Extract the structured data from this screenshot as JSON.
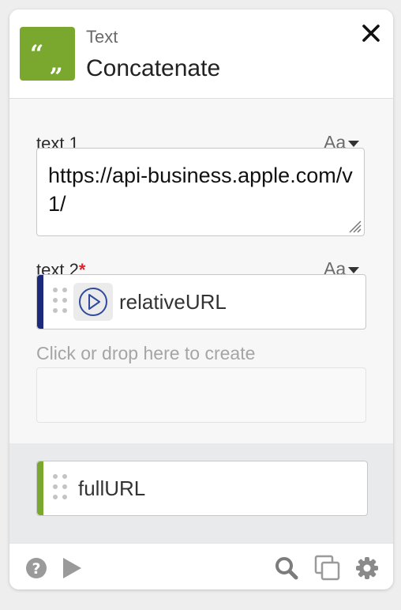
{
  "header": {
    "subtitle": "Text",
    "title": "Concatenate",
    "app_icon": "quote-marks-icon",
    "close_icon": "close-icon",
    "accent_color": "#7aa82e"
  },
  "fields": {
    "text1": {
      "label": "text 1",
      "type_toggle": "Aa",
      "value": "https://api-business.apple.com/v1/"
    },
    "text2": {
      "label": "text 2",
      "required_mark": "*",
      "type_toggle": "Aa",
      "token": "relativeURL",
      "token_icon": "play-circle-icon",
      "token_color": "#1b2a7a"
    },
    "create_placeholder": "Click or drop here to create"
  },
  "output": {
    "token": "fullURL",
    "token_color": "#7aa82e"
  },
  "footer": {
    "icons": [
      "help-icon",
      "play-icon",
      "search-icon",
      "duplicate-icon",
      "settings-gear-icon"
    ]
  }
}
